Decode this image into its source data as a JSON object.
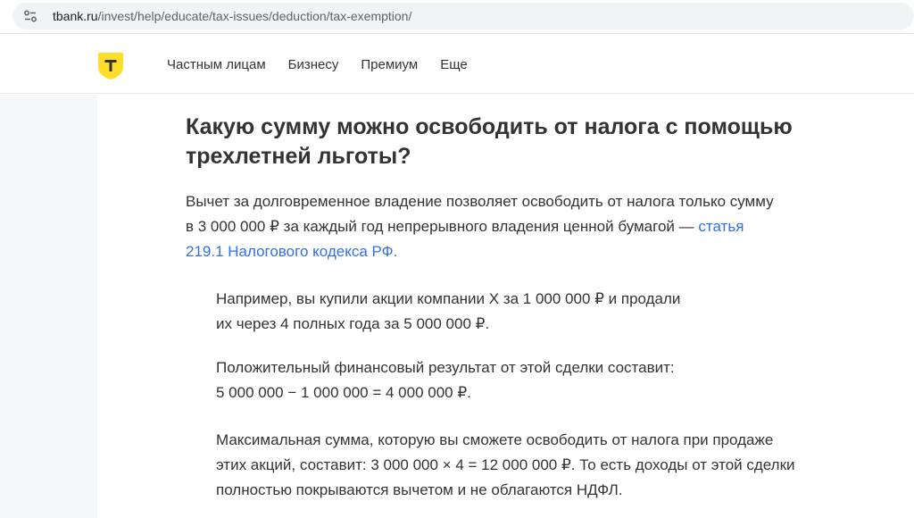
{
  "browser": {
    "url_host": "tbank.ru",
    "url_path": "/invest/help/educate/tax-issues/deduction/tax-exemption/"
  },
  "header": {
    "logo_letter": "Т",
    "nav": [
      "Частным лицам",
      "Бизнесу",
      "Премиум",
      "Еще"
    ]
  },
  "article": {
    "heading_line1": "Какую сумму можно освободить от налога с помощью",
    "heading_line2": "трехлетней льготы?",
    "lead_line1": "Вычет за долговременное владение позволяет освободить от налога только сумму",
    "lead_line2": "в 3 000 000 ₽ за каждый год непрерывного владения ценной бумагой — ",
    "lead_link_part1": "статья",
    "lead_link_part2": "219.1 Налогового кодекса РФ.",
    "example1_line1": "Например, вы купили акции компании X за 1 000 000 ₽ и продали",
    "example1_line2": "их через 4 полных года за 5 000 000 ₽.",
    "example2_line1": "Положительный финансовый результат от этой сделки составит:",
    "example2_line2": "5 000 000 − 1 000 000 = 4 000 000 ₽.",
    "example3_line1": "Максимальная сумма, которую вы сможете освободить от налога при продаже",
    "example3_line2": "этих акций, составит: 3 000 000 × 4 = 12 000 000 ₽. То есть доходы от этой сделки",
    "example3_line3": "полностью покрываются вычетом и не облагаются НДФЛ."
  },
  "colors": {
    "brand_yellow": "#ffdd2d",
    "link_blue": "#336fee",
    "text": "#333333"
  },
  "icons": {
    "site_info": "tune-icon"
  }
}
